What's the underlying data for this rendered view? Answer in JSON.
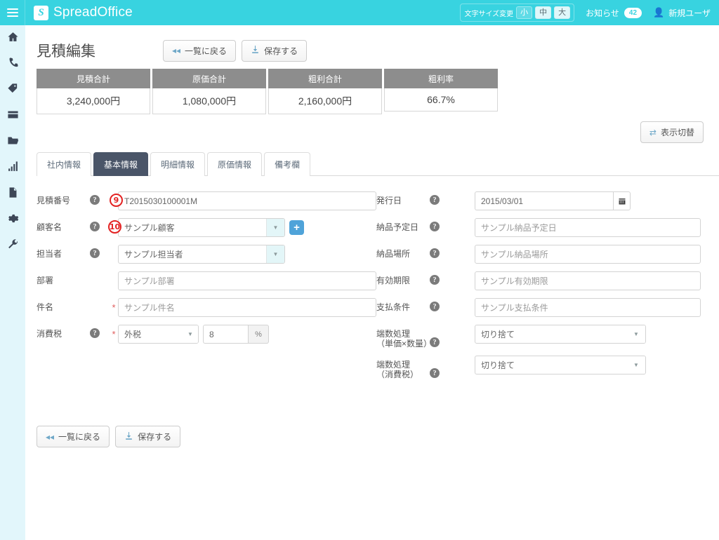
{
  "header": {
    "menu_icon": "hamburger-icon",
    "brand": "SpreadOffice",
    "brand_part1": "Spread",
    "brand_part2": "Office",
    "brand_logo_glyph": "S",
    "fontsize_label": "文字サイズ変更",
    "fontsize_options": [
      "小",
      "中",
      "大"
    ],
    "fontsize_selected": "中",
    "notice_label": "お知らせ",
    "notice_count": "42",
    "user_label": "新規ユーザ",
    "user_icon": "user-icon",
    "accent_color": "#38d3e0"
  },
  "sidebar": {
    "items": [
      {
        "icon": "home-icon",
        "name": "sidebar-item-home"
      },
      {
        "icon": "phone-icon",
        "name": "sidebar-item-phone"
      },
      {
        "icon": "tag-icon",
        "name": "sidebar-item-tag"
      },
      {
        "icon": "card-icon",
        "name": "sidebar-item-card"
      },
      {
        "icon": "folder-icon",
        "name": "sidebar-item-folder"
      },
      {
        "icon": "chart-icon",
        "name": "sidebar-item-chart"
      },
      {
        "icon": "document-icon",
        "name": "sidebar-item-document"
      },
      {
        "icon": "gear-icon",
        "name": "sidebar-item-settings"
      },
      {
        "icon": "wrench-icon",
        "name": "sidebar-item-tools"
      }
    ]
  },
  "page": {
    "title": "見積編集",
    "back_button": "一覧に戻る",
    "save_button": "保存する",
    "toggle_display_button": "表示切替"
  },
  "summary": {
    "columns": [
      {
        "header": "見積合計",
        "value": "3,240,000円"
      },
      {
        "header": "原価合計",
        "value": "1,080,000円"
      },
      {
        "header": "粗利合計",
        "value": "2,160,000円"
      },
      {
        "header": "粗利率",
        "value": "66.7%"
      }
    ]
  },
  "tabs": [
    {
      "label": "社内情報",
      "active": false
    },
    {
      "label": "基本情報",
      "active": true
    },
    {
      "label": "明細情報",
      "active": false
    },
    {
      "label": "原価情報",
      "active": false
    },
    {
      "label": "備考欄",
      "active": false
    }
  ],
  "form_left": {
    "quote_number": {
      "label": "見積番号",
      "value": "T2015030100001M",
      "marker": "9"
    },
    "customer_name": {
      "label": "顧客名",
      "value": "サンプル顧客",
      "marker": "10",
      "add_button": "+"
    },
    "person_in_charge": {
      "label": "担当者",
      "value": "サンプル担当者"
    },
    "department": {
      "label": "部署",
      "value": "サンプル部署"
    },
    "subject": {
      "label": "件名",
      "value": "サンプル件名",
      "required": "*"
    },
    "tax": {
      "label": "消費税",
      "type_value": "外税",
      "rate_value": "8",
      "unit": "%",
      "required": "*"
    }
  },
  "form_right": {
    "issue_date": {
      "label": "発行日",
      "value": "2015/03/01",
      "calendar_icon": "calendar-icon"
    },
    "delivery_date": {
      "label": "納品予定日",
      "value": "サンプル納品予定日"
    },
    "delivery_place": {
      "label": "納品場所",
      "value": "サンプル納品場所"
    },
    "valid_until": {
      "label": "有効期限",
      "value": "サンプル有効期限"
    },
    "payment_terms": {
      "label": "支払条件",
      "value": "サンプル支払条件"
    },
    "rounding_unit": {
      "label_line1": "端数処理",
      "label_line2": "（単価×数量）",
      "value": "切り捨て"
    },
    "rounding_tax": {
      "label_line1": "端数処理",
      "label_line2": "（消費税）",
      "value": "切り捨て"
    }
  },
  "footer": {
    "back_button": "一覧に戻る",
    "save_button": "保存する"
  }
}
